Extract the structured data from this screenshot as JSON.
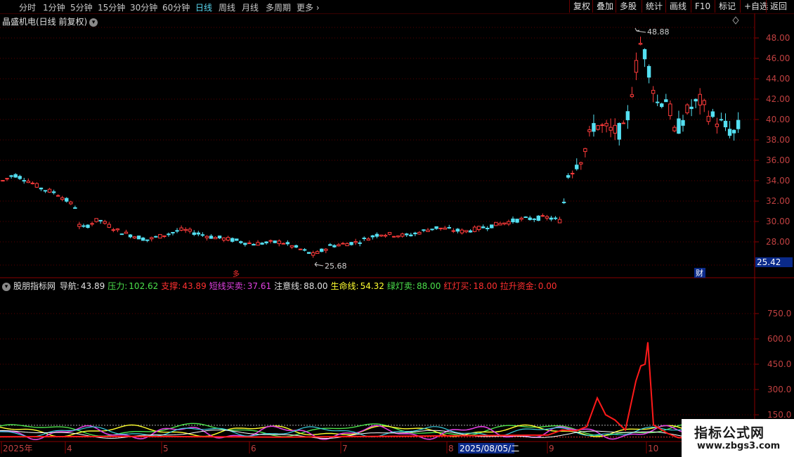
{
  "toolbar": {
    "timeframes": [
      {
        "label": "分时"
      },
      {
        "label": "1分钟"
      },
      {
        "label": "5分钟"
      },
      {
        "label": "15分钟"
      },
      {
        "label": "30分钟"
      },
      {
        "label": "60分钟"
      },
      {
        "label": "日线",
        "active": true
      },
      {
        "label": "周线"
      },
      {
        "label": "月线"
      },
      {
        "label": "多周期"
      },
      {
        "label": "更多"
      }
    ],
    "right_buttons": [
      {
        "label": "复权"
      },
      {
        "label": "叠加"
      },
      {
        "label": "多股"
      },
      {
        "label": "统计"
      },
      {
        "label": "画线"
      },
      {
        "label": "F10"
      },
      {
        "label": "标记"
      },
      {
        "label": "+自选"
      },
      {
        "label": "返回"
      }
    ]
  },
  "chart": {
    "title": "晶盛机电(日线 前复权)",
    "current_price_tag": "25.42",
    "high_label": "48.88",
    "low_label": "25.68",
    "fin_marker": "财",
    "event_marker": "多",
    "price_axis": [
      "48.00",
      "46.00",
      "44.00",
      "42.00",
      "40.00",
      "38.00",
      "36.00",
      "34.00",
      "32.00",
      "30.00",
      "28.00"
    ],
    "colors": {
      "up": "#ff3b3b",
      "down": "#54e0f2",
      "grid": "#5a0000",
      "axis_text": "#c04040"
    }
  },
  "indicator": {
    "name": "股朋指标网",
    "items": [
      {
        "label": "导航:",
        "value": "43.89",
        "color": "#e0e0e0"
      },
      {
        "label": "压力:",
        "value": "102.62",
        "color": "#4be04b"
      },
      {
        "label": "支撑:",
        "value": "43.89",
        "color": "#ff3030"
      },
      {
        "label": "短线买卖:",
        "value": "37.61",
        "color": "#e040e0"
      },
      {
        "label": "注意线:",
        "value": "88.00",
        "color": "#e0e0e0"
      },
      {
        "label": "生命线:",
        "value": "54.32",
        "color": "#ffff30"
      },
      {
        "label": "绿灯卖:",
        "value": "88.00",
        "color": "#4be04b"
      },
      {
        "label": "红灯买:",
        "value": "18.00",
        "color": "#ff3030"
      },
      {
        "label": "拉升资金:",
        "value": "0.00",
        "color": "#ff3030"
      }
    ],
    "axis": [
      "750.0",
      "600.0",
      "450.0",
      "300.0",
      "150.0"
    ]
  },
  "date_axis": {
    "labels": [
      "2025年",
      "4",
      "5",
      "6",
      "7",
      "8",
      "9",
      "10"
    ],
    "cursor_date": "2025/08/05/二"
  },
  "watermark": {
    "line1": "指标公式网",
    "line2": "www.zbgs3.com"
  }
}
